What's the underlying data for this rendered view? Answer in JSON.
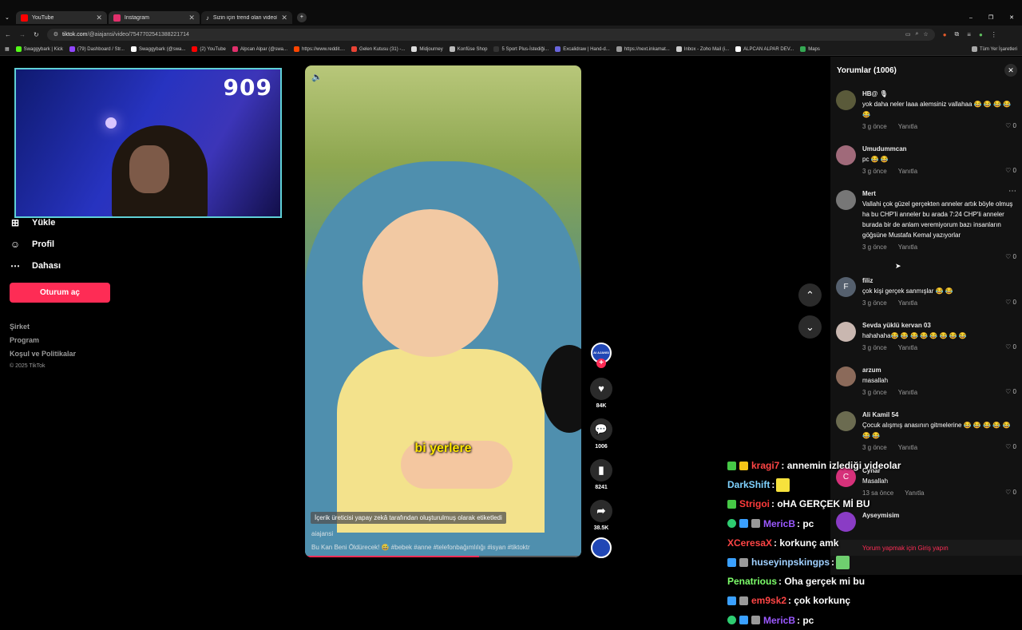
{
  "browser": {
    "tabs": [
      {
        "label": "YouTube",
        "color": "#ff0000"
      },
      {
        "label": "Instagram",
        "color": "#e1306c"
      },
      {
        "label": "Sizin için trend olan videoları iz",
        "color": "#ffffff"
      }
    ],
    "url_host": "tiktok.com",
    "url_path": "/@aiajansi/video/7547702541388221714",
    "bookmarks": [
      "Swaggybark | Kick",
      "(79) Dashboard / Str...",
      "Swaggybark (@swa...",
      "(2) YouTube",
      "Alpcan Alpar (@swa...",
      "https://www.reddit....",
      "Gelen Kutusu (31) -...",
      "Midjourney",
      "Konfüse Shop",
      "5 Sport Plus-İstediği...",
      "Excalidraw | Hand-d...",
      "https://next.inkamat...",
      "Inbox - Zoho Mail (i...",
      "ALPCAN ALPAR DEV...",
      "Maps"
    ],
    "all_bookmarks": "Tüm Yer İşaretleri"
  },
  "webcam": {
    "counter": "909"
  },
  "leftnav": {
    "items": [
      {
        "label": "Yükle",
        "icon": "plus-box-icon"
      },
      {
        "label": "Profil",
        "icon": "person-icon"
      },
      {
        "label": "Dahası",
        "icon": "more-icon"
      }
    ],
    "login": "Oturum aç",
    "footer": [
      "Şirket",
      "Program",
      "Koşul ve Politikalar"
    ],
    "copyright": "© 2025 TikTok"
  },
  "video": {
    "subtitle": "bi yerlere",
    "ai_label": "İçerik üreticisi yapay zekâ tarafından oluşturulmuş olarak etiketledi",
    "author": "aiajansi",
    "caption": "Bu Kan Beni Öldürecek! 😅 #bebek #anne #telefonbağımlılığı #isyan #tiktoktr",
    "progress": 0.63,
    "likes": "84K",
    "comments": "1006",
    "saves": "8241",
    "shares": "38.5K",
    "ai_avatar": "AI AJANSI"
  },
  "comments": {
    "title": "Yorumlar (1006)",
    "reply": "Yanıtla",
    "items": [
      {
        "user": "HB@ 🎙",
        "text": "yok daha neler laaa alemsiniz vallahaa 😂 😂 😂 😂 😂",
        "time": "3 g önce",
        "likes": "0",
        "color": "#5a5a3a"
      },
      {
        "user": "Umudummcan",
        "text": "pc 😂 😂",
        "time": "3 g önce",
        "likes": "0",
        "color": "#a06a7a"
      },
      {
        "user": "Mert",
        "text": "Vallahi çok güzel gerçekten anneler artık böyle olmuş ha bu CHP'li anneler bu arada 7:24 CHP'li anneler burada bir de anlam veremiyorum bazı insanların göğsüne Mustafa Kemal yazıyorlar",
        "time": "3 g önce",
        "likes": "0",
        "color": "#777777"
      },
      {
        "user": "filiz",
        "text": "çok kişi gerçek sanmışlar 😂 😂",
        "time": "3 g önce",
        "likes": "0",
        "color": "#55606e",
        "initial": "F"
      },
      {
        "user": "Sevda yüklü kervan 03",
        "text": "hahahaha😂 😂 😂 😂 😂 😂 😂 😂",
        "time": "3 g önce",
        "likes": "0",
        "color": "#c9b7b0"
      },
      {
        "user": "arzum",
        "text": "masallah",
        "time": "3 g önce",
        "likes": "0",
        "color": "#8b6a5a"
      },
      {
        "user": "Ali Kamil 54",
        "text": "Çocuk alışmış anasının gitmelerine 😂 😂 😂 😂 😂 😂 😂",
        "time": "3 g önce",
        "likes": "0",
        "color": "#6b6b50"
      },
      {
        "user": "Cynar",
        "text": "Masallah",
        "time": "13 sa önce",
        "likes": "0",
        "color": "#d6317a",
        "initial": "C"
      },
      {
        "user": "Ayseymisim",
        "text": "",
        "time": "",
        "likes": "",
        "color": "#8a3cc5"
      }
    ],
    "login_prompt": "Yorum yapmak için Giriş yapın"
  },
  "chat": [
    {
      "user": "kragi7",
      "msg": ": annemin izlediği videolar",
      "color": "#ff4545"
    },
    {
      "user": "DarkShift",
      "msg": ":",
      "color": "#7fd2ff"
    },
    {
      "user": "Strigoi",
      "msg": ": oHA GERÇEK Mİ BU",
      "color": "#ff3b3b"
    },
    {
      "user": "MericB",
      "msg": ": pc",
      "color": "#9b59ff"
    },
    {
      "user": "XCeresaX",
      "msg": ": korkunç amk",
      "color": "#ff4545"
    },
    {
      "user": "huseyinpskingps",
      "msg": ":",
      "color": "#9fd0ff"
    },
    {
      "user": "Penatrious",
      "msg": ": Oha gerçek mi bu",
      "color": "#7dff6a"
    },
    {
      "user": "em9sk2",
      "msg": ": çok korkunç",
      "color": "#ff4545"
    },
    {
      "user": "MericB",
      "msg": ": pc",
      "color": "#9b59ff"
    }
  ]
}
